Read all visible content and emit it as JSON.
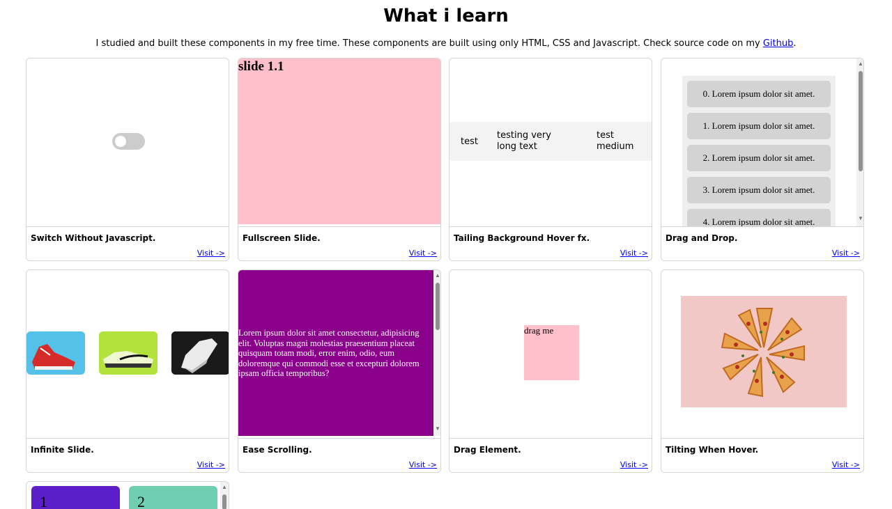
{
  "header": {
    "title": "What i learn",
    "subtitle_text": "I studied and built these components in my free time. These components are built using only HTML, CSS and Javascript. Check source code on my ",
    "github_link": "Github",
    "subtitle_end": "."
  },
  "cards": [
    {
      "title": "Switch Without Javascript.",
      "visit": "Visit ->"
    },
    {
      "title": "Fullscreen Slide.",
      "visit": "Visit ->",
      "slide_label": "slide 1.1"
    },
    {
      "title": "Tailing Background Hover fx.",
      "visit": "Visit ->",
      "cells": [
        "test",
        "testing very long text",
        "test medium"
      ]
    },
    {
      "title": "Drag and Drop.",
      "visit": "Visit ->",
      "items": [
        "0. Lorem ipsum dolor sit amet.",
        "1. Lorem ipsum dolor sit amet.",
        "2. Lorem ipsum dolor sit amet.",
        "3. Lorem ipsum dolor sit amet.",
        "4. Lorem ipsum dolor sit amet."
      ]
    },
    {
      "title": "Infinite Slide.",
      "visit": "Visit ->"
    },
    {
      "title": "Ease Scrolling.",
      "visit": "Visit ->",
      "text": "Lorem ipsum dolor sit amet consectetur, adipisicing elit. Voluptas magni molestias praesentium placeat quisquam totam modi, error enim, odio, eum doloremque qui commodi esse et excepturi dolorem ipsam officia temporibus?"
    },
    {
      "title": "Drag Element.",
      "visit": "Visit ->",
      "box_label": "drag me"
    },
    {
      "title": "Tilting When Hover.",
      "visit": "Visit ->"
    },
    {
      "mini_labels": [
        "1",
        "2"
      ]
    }
  ],
  "colors": {
    "pink": "#ffc0cb",
    "purple": "#8b008b",
    "mini1": "#5b1ec9",
    "mini2": "#6fcfb0"
  },
  "icons": {
    "switch": "toggle-switch-icon",
    "shoes": [
      "red-sneaker-image",
      "lime-sneaker-image",
      "white-sneaker-image"
    ],
    "pizza": "pizza-image"
  }
}
